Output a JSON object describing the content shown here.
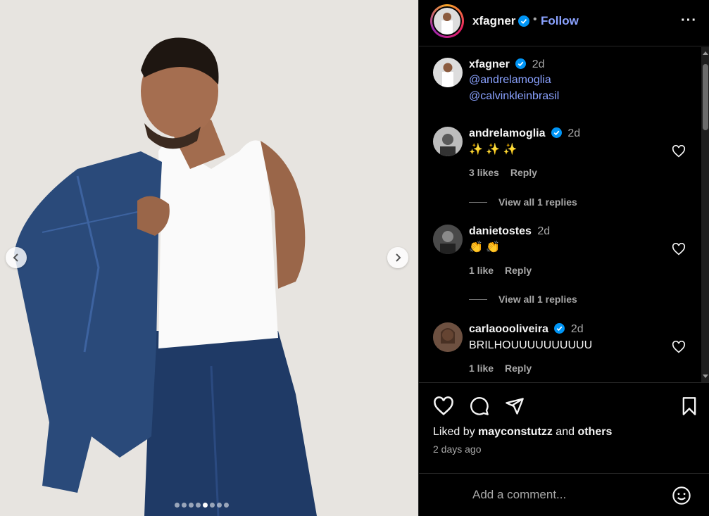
{
  "post": {
    "username": "xfagner",
    "separator": "•",
    "follow_label": "Follow",
    "more_label": "···",
    "caption": {
      "username": "xfagner",
      "time": "2d",
      "mentions": [
        "@andrelamoglia",
        "@calvinkleinbrasil"
      ]
    }
  },
  "carousel": {
    "total": 8,
    "active_index": 4
  },
  "comments": [
    {
      "username": "andrelamoglia",
      "verified": true,
      "time": "2d",
      "text": "✨ ✨ ✨",
      "likes": "3 likes",
      "reply": "Reply",
      "view_replies": "View all 1 replies"
    },
    {
      "username": "danietostes",
      "verified": false,
      "time": "2d",
      "text": "👏 👏",
      "likes": "1 like",
      "reply": "Reply",
      "view_replies": "View all 1 replies"
    },
    {
      "username": "carlaoooliveira",
      "verified": true,
      "time": "2d",
      "text": "BRILHOUUUUUUUUUU",
      "likes": "1 like",
      "reply": "Reply"
    }
  ],
  "liked_by": {
    "prefix": "Liked by",
    "user": "mayconstutzz",
    "and": "and",
    "others": "others"
  },
  "posted_ago": "2 days ago",
  "add_comment": {
    "placeholder": "Add a comment..."
  },
  "colors": {
    "link": "#8aa2ff",
    "verified": "#0095f6",
    "muted": "#a8a8a8"
  },
  "icons": [
    "chevron-left-icon",
    "chevron-right-icon",
    "verified-icon",
    "more-icon",
    "heart-icon",
    "comment-icon",
    "share-icon",
    "bookmark-icon",
    "emoji-icon"
  ]
}
